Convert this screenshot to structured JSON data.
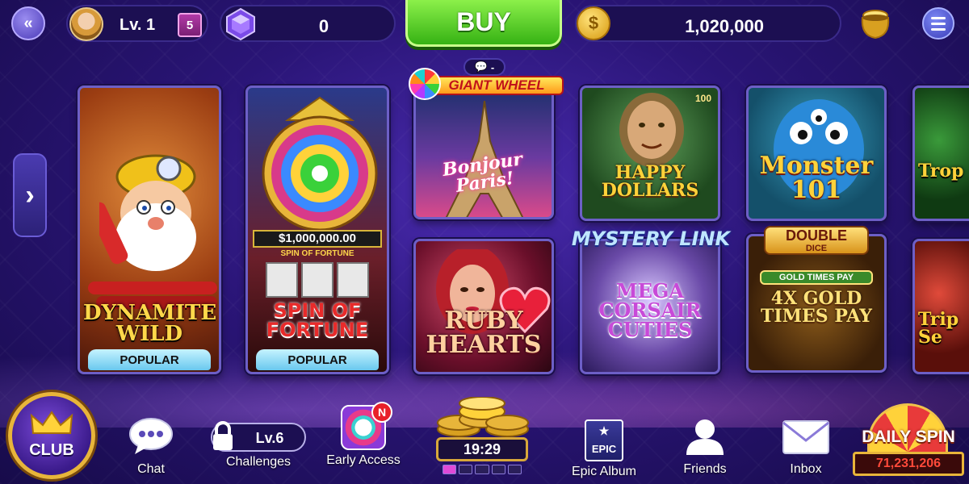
{
  "header": {
    "back_icon": "back-arrow-icon",
    "level_label": "Lv. 1",
    "gift_count": "5",
    "gems": "0",
    "buy_label": "BUY",
    "coins": "1,020,000",
    "menu_icon": "hamburger-menu-icon"
  },
  "games": [
    {
      "id": "dynamite",
      "title": "DYNAMITE WILD",
      "badge": "POPULAR"
    },
    {
      "id": "spin",
      "title": "SPIN OF FORTUNE",
      "jackpot": "$1,000,000.00",
      "subtitle": "SPIN OF FORTUNE",
      "badge": "POPULAR"
    },
    {
      "id": "giantwheel",
      "logo": "GIANT WHEEL",
      "title": "Bonjour Paris!",
      "bubble": "-"
    },
    {
      "id": "ruby",
      "title": "RUBY HEARTS"
    },
    {
      "id": "happy",
      "title": "HAPPY DOLLARS",
      "note": "100"
    },
    {
      "id": "mystery",
      "logo": "MYSTERY LINK",
      "title": "MEGA CORSAIR CUTIES"
    },
    {
      "id": "monster",
      "title": "Monster 101"
    },
    {
      "id": "double",
      "logo": "DOUBLE",
      "logo_sub": "DICE",
      "title": "4X GOLD TIMES PAY",
      "banner": "GOLD TIMES PAY"
    },
    {
      "id": "trop",
      "title": "Trop"
    },
    {
      "id": "triple",
      "title": "Trip Se"
    }
  ],
  "bottom_nav": {
    "club_label": "CLUB",
    "chat_label": "Chat",
    "challenges_level": "Lv.6",
    "challenges_label": "Challenges",
    "early_access_label": "Early Access",
    "early_access_badge": "N",
    "timer": "19:29",
    "progress": {
      "filled": 1,
      "total": 5
    },
    "epic_label": "Epic Album",
    "epic_icon_text": "EPIC",
    "friends_label": "Friends",
    "inbox_label": "Inbox",
    "daily_spin_label": "DAILY SPIN",
    "daily_spin_value": "71,231,206"
  },
  "colors": {
    "background": "#2a1577",
    "buy_green": "#36b214",
    "coin_gold": "#d79a10",
    "badge_blue": "#69c8ee",
    "notification_red": "#e8202a"
  }
}
